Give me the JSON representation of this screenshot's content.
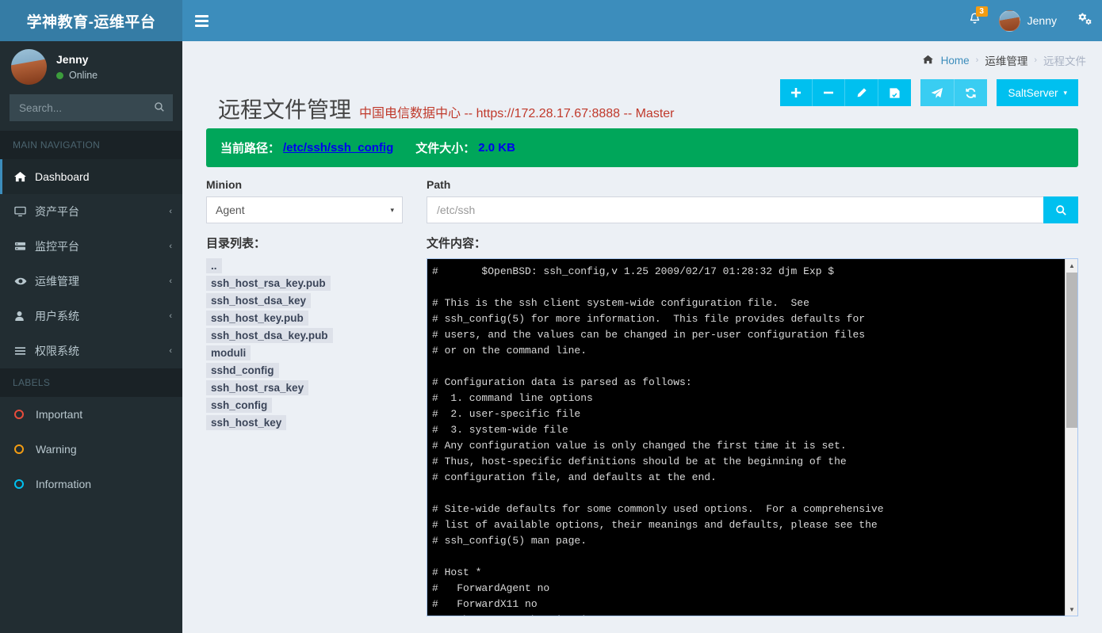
{
  "header": {
    "logo_text": "学神教育-运维平台",
    "menu_toggle": "≡",
    "notifications_badge": "3",
    "user_name": "Jenny"
  },
  "sidebar": {
    "user_name": "Jenny",
    "user_status": "Online",
    "search_placeholder": "Search...",
    "nav_heading": "MAIN NAVIGATION",
    "labels_heading": "LABELS",
    "items": [
      {
        "label": "Dashboard",
        "icon": "home-icon",
        "glyph": "⌂",
        "arrow": "",
        "active": true
      },
      {
        "label": "资产平台",
        "icon": "desktop-icon",
        "glyph": "⬜",
        "arrow": "‹",
        "active": false
      },
      {
        "label": "监控平台",
        "icon": "server-icon",
        "glyph": "☰",
        "arrow": "‹",
        "active": false
      },
      {
        "label": "运维管理",
        "icon": "eye-icon",
        "glyph": "◉",
        "arrow": "‹",
        "active": false
      },
      {
        "label": "用户系统",
        "icon": "user-icon",
        "glyph": "♟",
        "arrow": "‹",
        "active": false
      },
      {
        "label": "权限系统",
        "icon": "bars-icon",
        "glyph": "≡",
        "arrow": "‹",
        "active": false
      }
    ],
    "labels": [
      {
        "label": "Important",
        "color": "#e74c3c"
      },
      {
        "label": "Warning",
        "color": "#f39c12"
      },
      {
        "label": "Information",
        "color": "#00c0ef"
      }
    ]
  },
  "breadcrumb": {
    "home": "Home",
    "sep": "›",
    "level2": "运维管理",
    "level3": "远程文件"
  },
  "page": {
    "title": "远程文件管理",
    "subtitle": "中国电信数据中心 -- https://172.28.17.67:8888 -- Master"
  },
  "toolbar": {
    "add_label": "+",
    "remove_label": "−",
    "edit_label": "pencil-icon",
    "save_label": "save-icon",
    "send_label": "paper-plane-icon",
    "refresh_label": "refresh-icon",
    "server_label": "SaltServer",
    "server_caret": "▾"
  },
  "alert": {
    "path_label": "当前路径：",
    "path_value": "/etc/ssh/ssh_config",
    "size_label": "文件大小：",
    "size_value": "2.0 KB"
  },
  "form": {
    "minion_label": "Minion",
    "minion_value": "Agent",
    "minion_caret": "▾",
    "path_label": "Path",
    "path_placeholder": "/etc/ssh",
    "path_value": ""
  },
  "dir_panel": {
    "title": "目录列表：",
    "items": [
      "..",
      "ssh_host_rsa_key.pub",
      "ssh_host_dsa_key",
      "ssh_host_key.pub",
      "ssh_host_dsa_key.pub",
      "moduli",
      "sshd_config",
      "ssh_host_rsa_key",
      "ssh_config",
      "ssh_host_key"
    ]
  },
  "file_panel": {
    "title": "文件内容：",
    "content": "#\t$OpenBSD: ssh_config,v 1.25 2009/02/17 01:28:32 djm Exp $\n\n# This is the ssh client system-wide configuration file.  See\n# ssh_config(5) for more information.  This file provides defaults for\n# users, and the values can be changed in per-user configuration files\n# or on the command line.\n\n# Configuration data is parsed as follows:\n#  1. command line options\n#  2. user-specific file\n#  3. system-wide file\n# Any configuration value is only changed the first time it is set.\n# Thus, host-specific definitions should be at the beginning of the\n# configuration file, and defaults at the end.\n\n# Site-wide defaults for some commonly used options.  For a comprehensive\n# list of available options, their meanings and defaults, please see the\n# ssh_config(5) man page.\n\n# Host *\n#   ForwardAgent no\n#   ForwardX11 no\n#   RhostsRSAAuthentication no",
    "scroll_up": "▲",
    "scroll_down": "▼"
  },
  "colors": {
    "header_blue": "#3c8dbc",
    "logo_blue": "#357ca5",
    "sidebar_dark": "#222d32",
    "accent_cyan": "#00c0ef",
    "success_green": "#00a65a",
    "subtitle_red": "#c0392b",
    "link_blue": "#0000ee"
  }
}
